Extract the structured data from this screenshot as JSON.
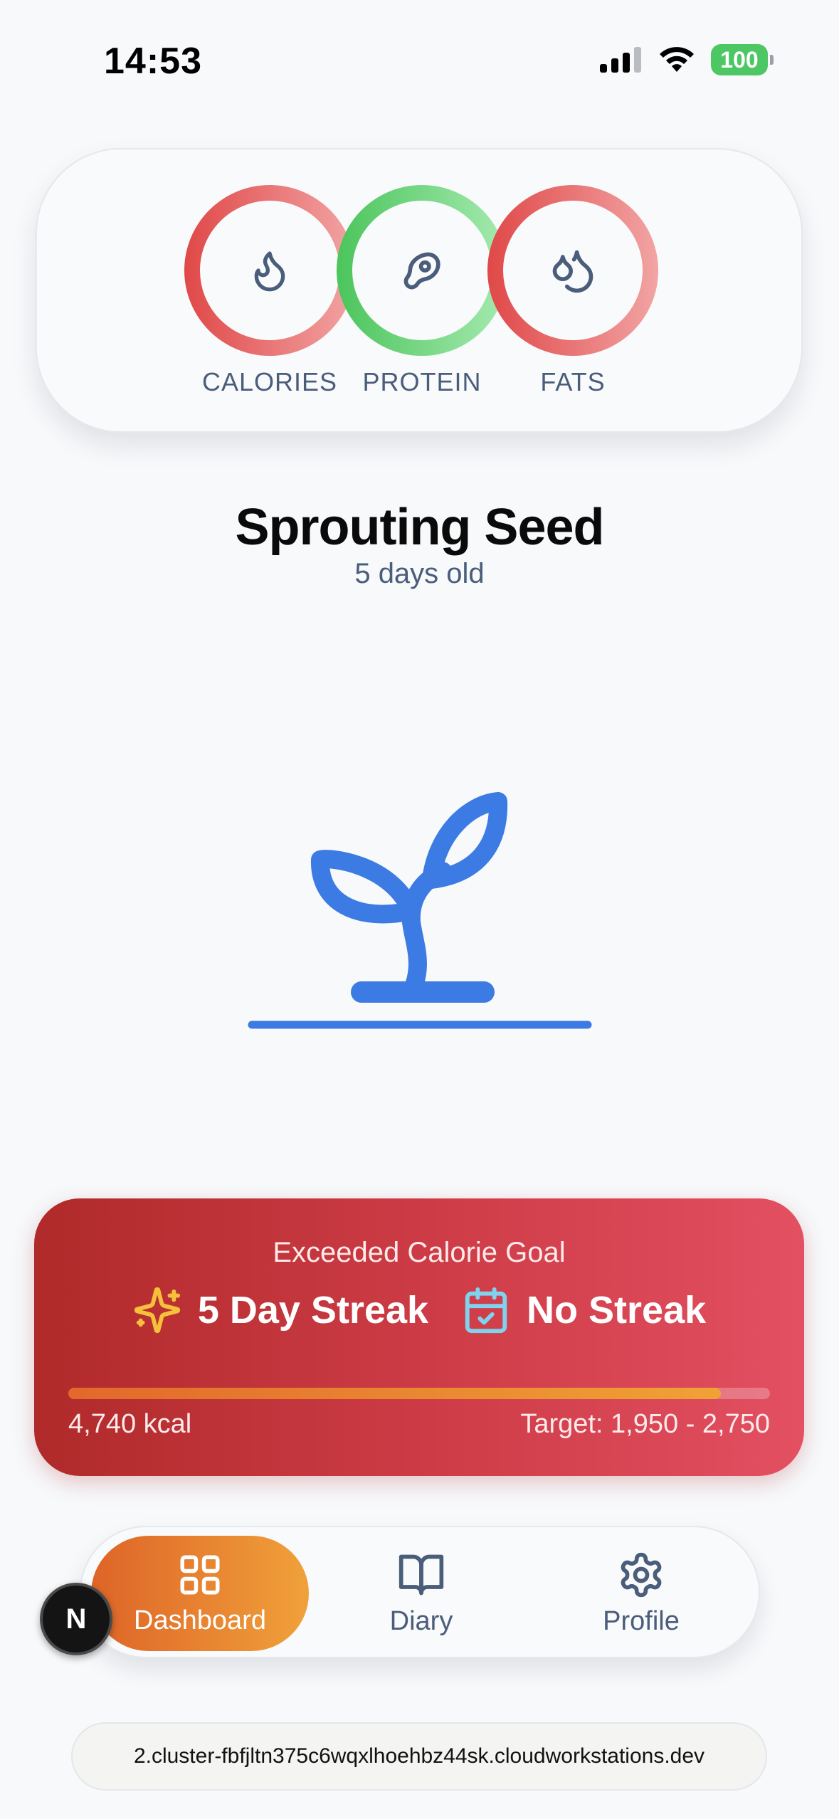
{
  "status_bar": {
    "time": "14:53",
    "battery": "100",
    "icons": [
      "cellular-signal-icon",
      "wifi-icon",
      "battery-icon"
    ]
  },
  "macros": [
    {
      "label": "CALORIES",
      "icon": "flame-icon",
      "color_start": "#e04848",
      "color_end": "#f2a4a4"
    },
    {
      "label": "PROTEIN",
      "icon": "meat-icon",
      "color_start": "#4cc55c",
      "color_end": "#a5eab0"
    },
    {
      "label": "FATS",
      "icon": "droplets-icon",
      "color_start": "#e04848",
      "color_end": "#f2a4a4"
    }
  ],
  "plant": {
    "title": "Sprouting Seed",
    "age": "5 days old",
    "icon": "sprout-icon",
    "color": "#3b7be3"
  },
  "streak_card": {
    "heading": "Exceeded Calorie Goal",
    "streak_primary": "5 Day Streak",
    "streak_primary_icon": "sparkles-icon",
    "streak_secondary": "No Streak",
    "streak_secondary_icon": "calendar-check-icon",
    "progress_fraction": 0.93,
    "kcal_value": "4,740 kcal",
    "target": "Target: 1,950 - 2,750",
    "gradient_start": "#b02a2a",
    "gradient_end": "#e25062"
  },
  "nav": {
    "items": [
      {
        "label": "Dashboard",
        "icon": "grid-icon",
        "active": true
      },
      {
        "label": "Diary",
        "icon": "book-open-icon",
        "active": false
      },
      {
        "label": "Profile",
        "icon": "gear-icon",
        "active": false
      }
    ],
    "accent_start": "#de6428",
    "accent_end": "#f0a13a"
  },
  "dev_badge": {
    "letter": "N"
  },
  "url_bar": {
    "url": "2.cluster-fbfjltn375c6wqxlhoehbz44sk.cloudworkstations.dev"
  }
}
